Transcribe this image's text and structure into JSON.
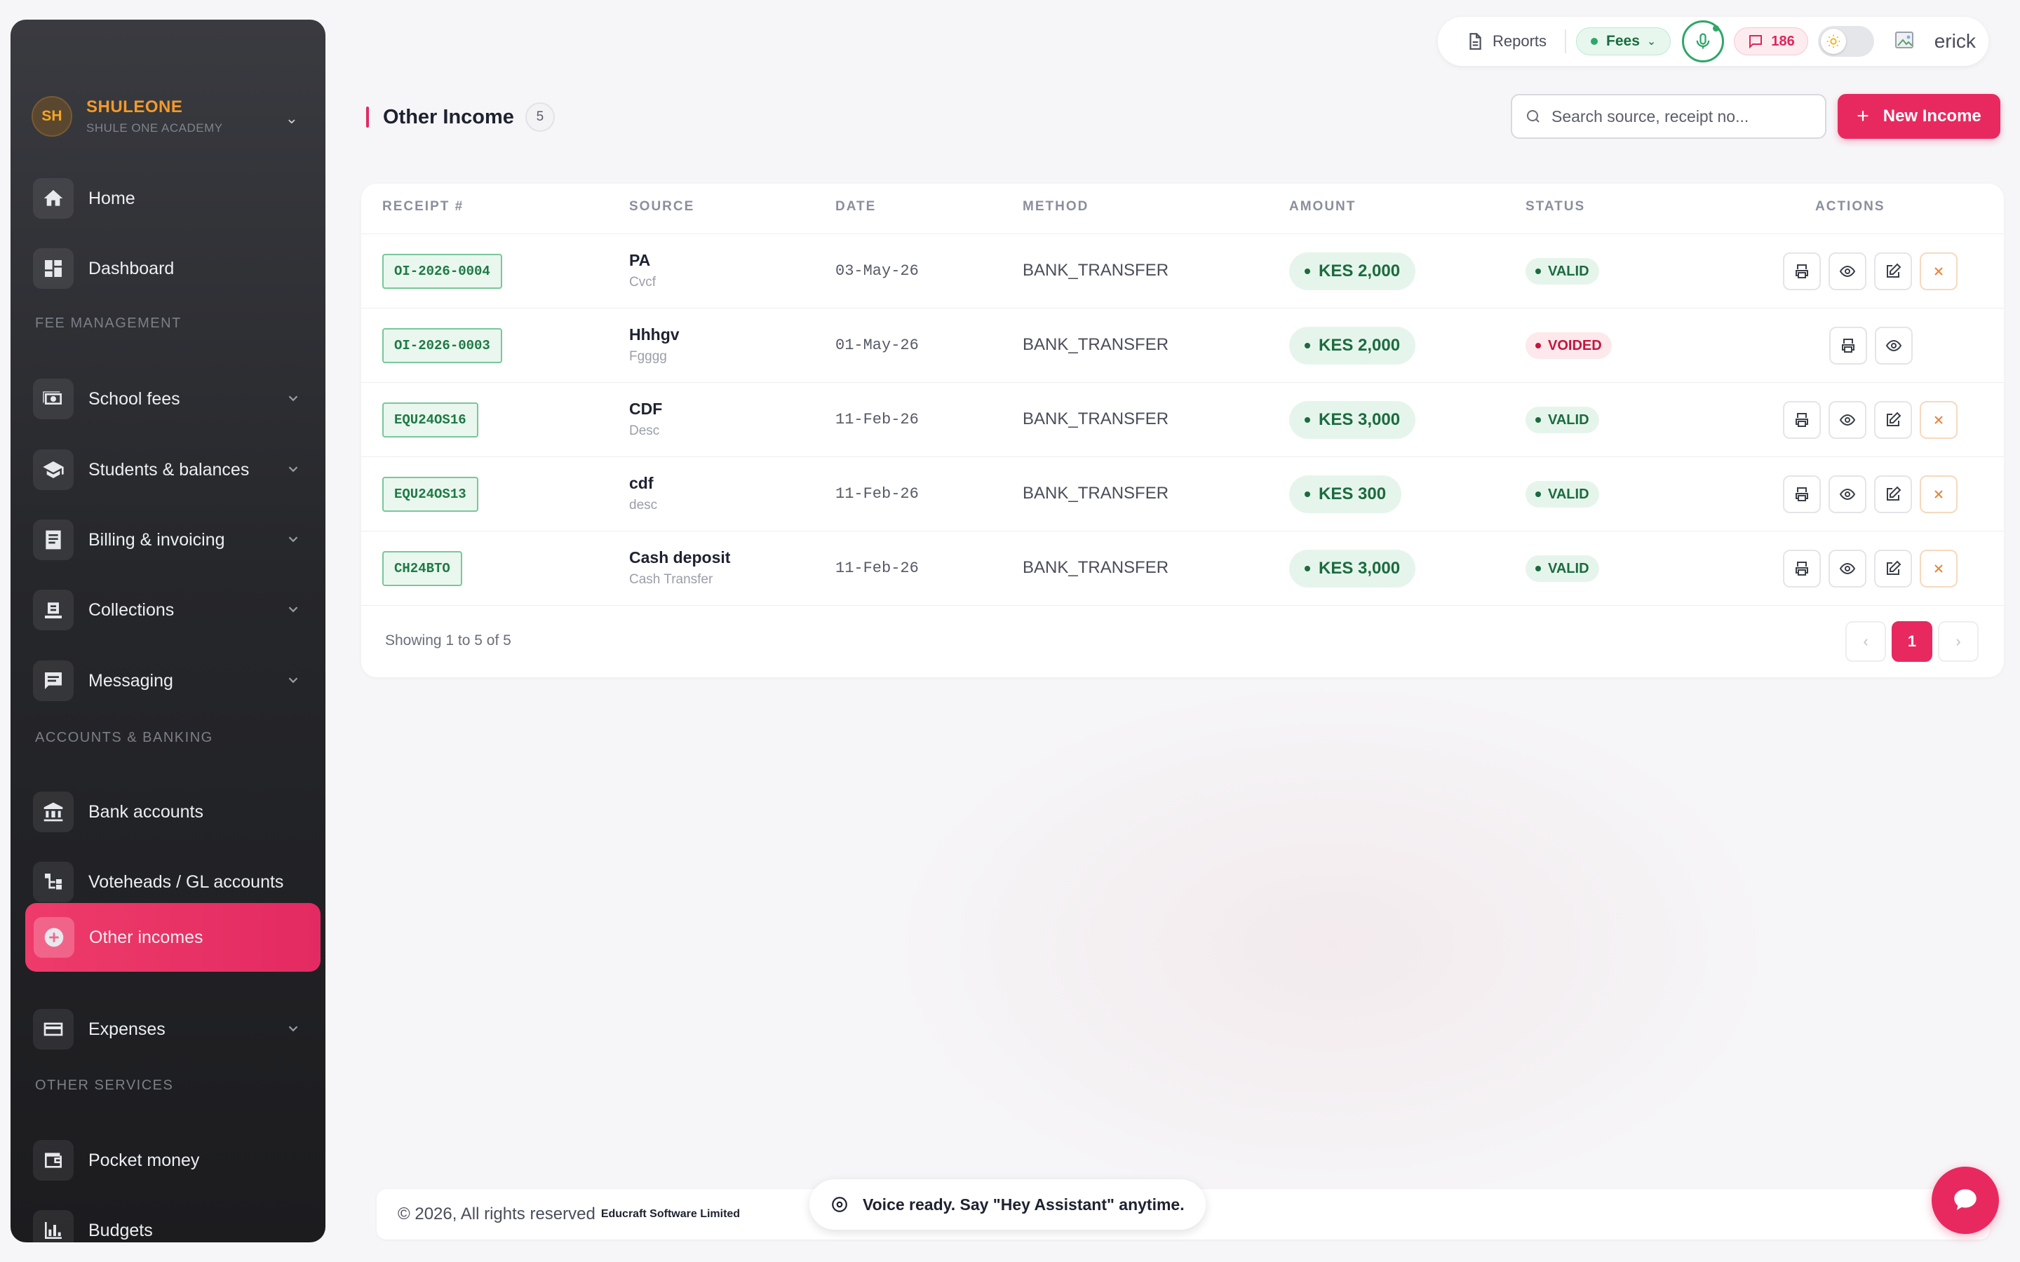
{
  "brand": {
    "initials": "SH",
    "name": "SHULEONE",
    "subtitle": "SHULE ONE ACADEMY"
  },
  "sidebar": {
    "sections": [
      "FEE MANAGEMENT",
      "ACCOUNTS & BANKING",
      "OTHER SERVICES"
    ],
    "items": [
      {
        "label": "Home",
        "icon": "home-icon"
      },
      {
        "label": "Dashboard",
        "icon": "dashboard-icon"
      },
      {
        "label": "School fees",
        "icon": "money-icon"
      },
      {
        "label": "Students & balances",
        "icon": "graduation-cap-icon"
      },
      {
        "label": "Billing & invoicing",
        "icon": "invoice-icon"
      },
      {
        "label": "Collections",
        "icon": "collections-icon"
      },
      {
        "label": "Messaging",
        "icon": "message-icon"
      },
      {
        "label": "Bank accounts",
        "icon": "bank-icon"
      },
      {
        "label": "Voteheads / GL accounts",
        "icon": "tree-icon"
      },
      {
        "label": "Other incomes",
        "icon": "plus-circle-icon"
      },
      {
        "label": "Expenses",
        "icon": "card-icon"
      },
      {
        "label": "Pocket money",
        "icon": "wallet-icon"
      },
      {
        "label": "Budgets",
        "icon": "bar-chart-icon"
      }
    ],
    "active": "Other incomes"
  },
  "topbar": {
    "reports_label": "Reports",
    "fees_label": "Fees",
    "messages_count": "186",
    "username": "erick",
    "colors": {
      "fees_dot": "#2ea76a",
      "mic": "#2ea76a",
      "messages": "#e0245b"
    }
  },
  "page": {
    "title": "Other Income",
    "count": "5",
    "search_placeholder": "Search source, receipt no...",
    "new_button": "New Income"
  },
  "table": {
    "headers": [
      "RECEIPT #",
      "SOURCE",
      "DATE",
      "METHOD",
      "AMOUNT",
      "STATUS",
      "ACTIONS"
    ],
    "rows": [
      {
        "receipt": "OI-2026-0004",
        "source": "PA",
        "source_sub": "Cvcf",
        "date": "03-May-26",
        "method": "BANK_TRANSFER",
        "amount": "KES 2,000",
        "status": "VALID"
      },
      {
        "receipt": "OI-2026-0003",
        "source": "Hhhgv",
        "source_sub": "Fgggg",
        "date": "01-May-26",
        "method": "BANK_TRANSFER",
        "amount": "KES 2,000",
        "status": "VOIDED"
      },
      {
        "receipt": "EQU24OS16",
        "source": "CDF",
        "source_sub": "Desc",
        "date": "11-Feb-26",
        "method": "BANK_TRANSFER",
        "amount": "KES 3,000",
        "status": "VALID"
      },
      {
        "receipt": "EQU24OS13",
        "source": "cdf",
        "source_sub": "desc",
        "date": "11-Feb-26",
        "method": "BANK_TRANSFER",
        "amount": "KES 300",
        "status": "VALID"
      },
      {
        "receipt": "CH24BTO",
        "source": "Cash deposit",
        "source_sub": "Cash Transfer",
        "date": "11-Feb-26",
        "method": "BANK_TRANSFER",
        "amount": "KES 3,000",
        "status": "VALID"
      }
    ],
    "showing": "Showing 1 to 5 of 5",
    "pager": {
      "prev": "‹",
      "current": "1",
      "next": "›"
    },
    "colors": {
      "valid": "#1b6b3e",
      "voided": "#c4163c",
      "accent": "#e8295f"
    }
  },
  "footer": {
    "copyright": "© 2026, All rights reserved",
    "company": "Educraft Software Limited"
  },
  "toast": {
    "message": "Voice ready. Say \"Hey Assistant\" anytime."
  }
}
